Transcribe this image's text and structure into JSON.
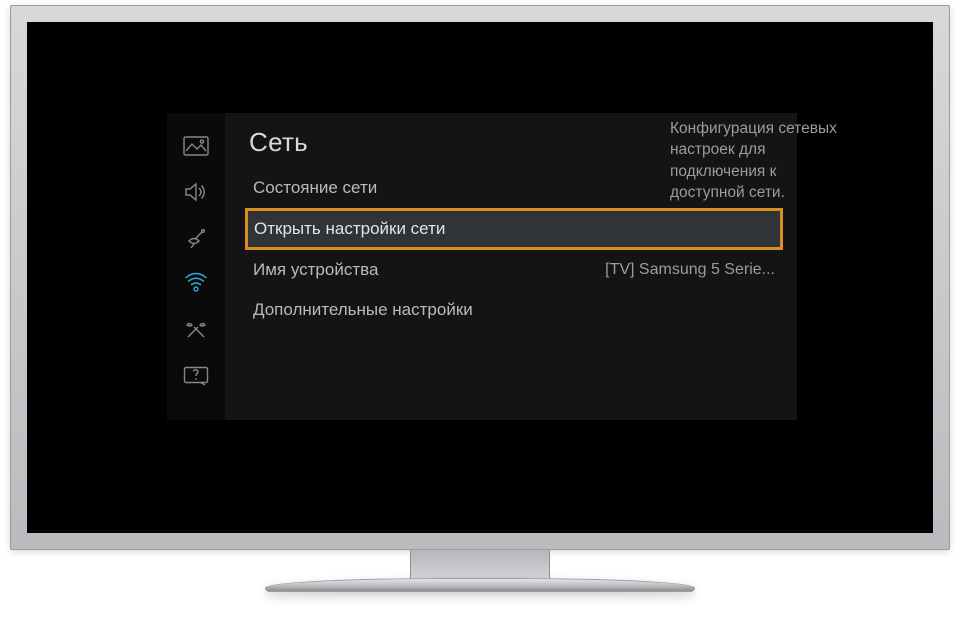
{
  "section_title": "Сеть",
  "description": "Конфигурация сетевых настроек для подключения к доступной сети.",
  "menu": {
    "items": [
      {
        "label": "Состояние сети",
        "value": ""
      },
      {
        "label": "Открыть настройки сети",
        "value": ""
      },
      {
        "label": "Имя устройства",
        "value": "[TV] Samsung 5 Serie..."
      },
      {
        "label": "Дополнительные настройки",
        "value": ""
      }
    ]
  },
  "sidebar": {
    "items": [
      {
        "name": "picture"
      },
      {
        "name": "sound"
      },
      {
        "name": "broadcast"
      },
      {
        "name": "network"
      },
      {
        "name": "system"
      },
      {
        "name": "support"
      }
    ]
  }
}
